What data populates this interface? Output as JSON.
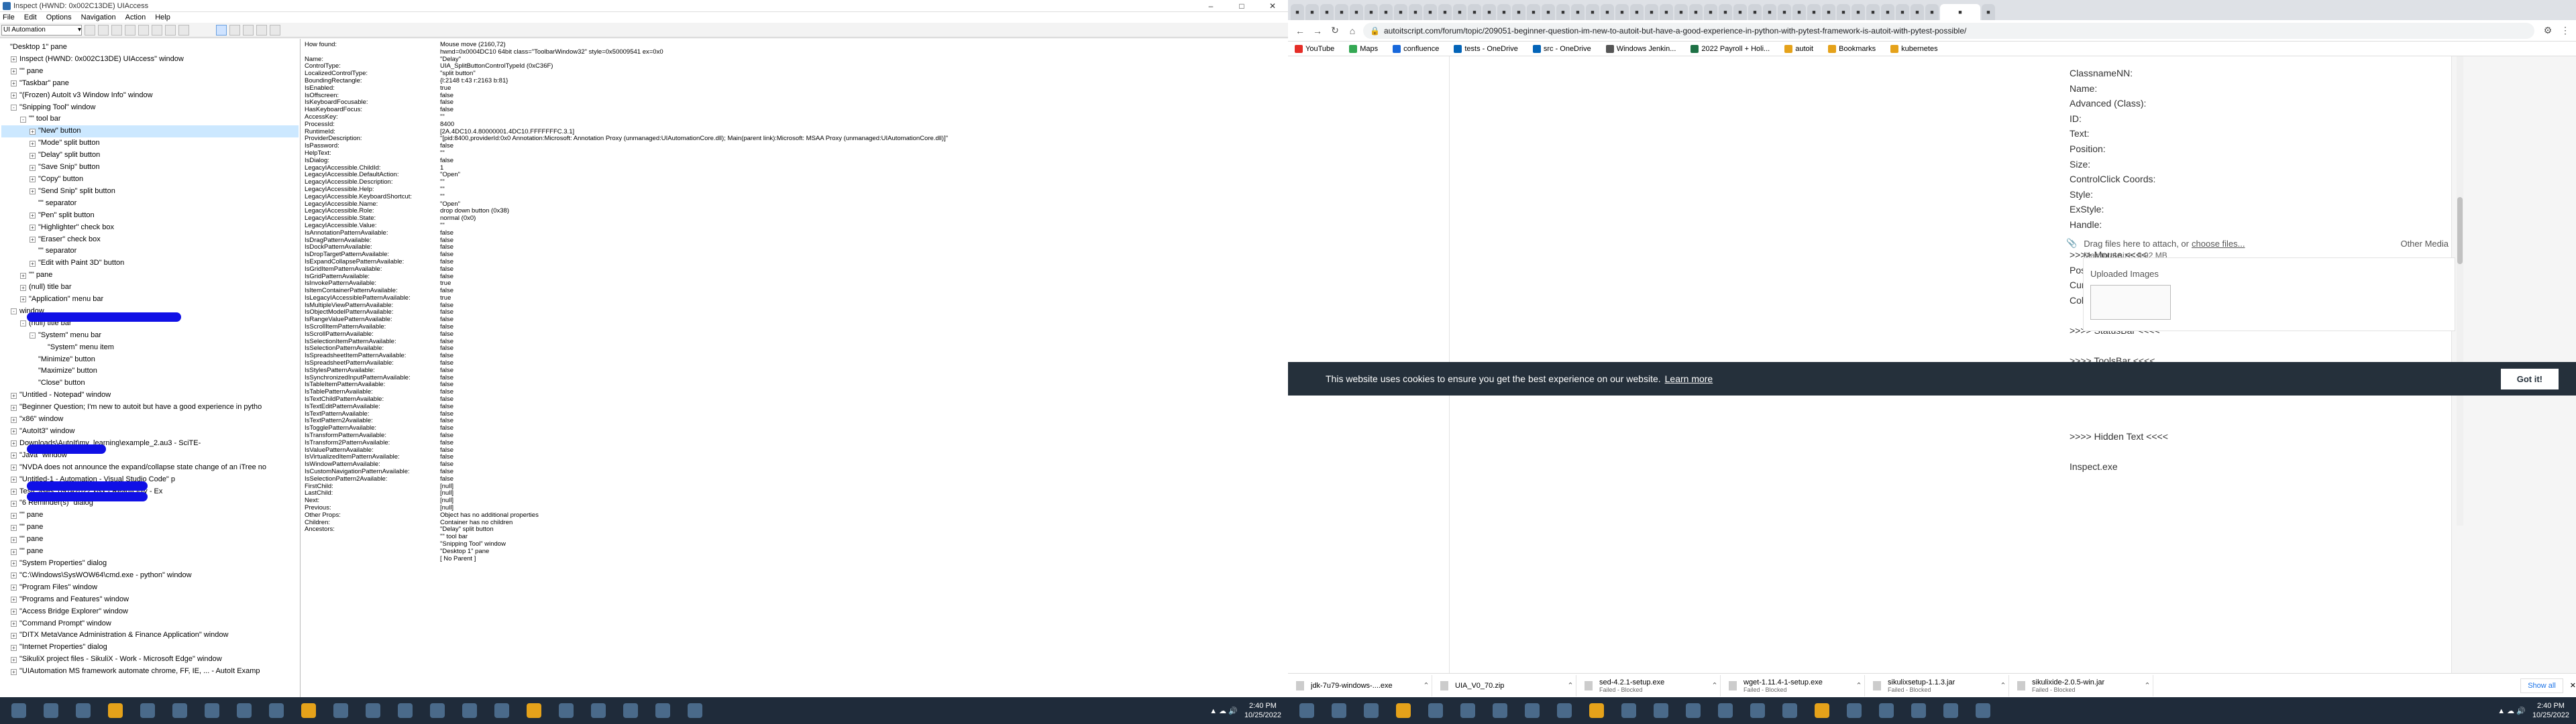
{
  "inspect": {
    "title": "Inspect (HWND: 0x002C13DE) UIAccess",
    "menu": [
      "File",
      "Edit",
      "Options",
      "Navigation",
      "Action",
      "Help"
    ],
    "mode": "UI Automation",
    "tree": [
      {
        "indent": 0,
        "tog": "",
        "text": "\"Desktop 1\" pane"
      },
      {
        "indent": 1,
        "tog": "+",
        "text": "Inspect  (HWND: 0x002C13DE) UIAccess\" window"
      },
      {
        "indent": 1,
        "tog": "+",
        "text": "\"\" pane"
      },
      {
        "indent": 1,
        "tog": "+",
        "text": "\"Taskbar\" pane"
      },
      {
        "indent": 1,
        "tog": "+",
        "text": "\"(Frozen) AutoIt v3 Window Info\" window"
      },
      {
        "indent": 1,
        "tog": "-",
        "text": "\"Snipping Tool\" window"
      },
      {
        "indent": 2,
        "tog": "-",
        "text": "\"\" tool bar"
      },
      {
        "indent": 3,
        "tog": "+",
        "text": "\"New\" button",
        "sel": true
      },
      {
        "indent": 3,
        "tog": "+",
        "text": "\"Mode\" split button"
      },
      {
        "indent": 3,
        "tog": "+",
        "text": "\"Delay\" split button"
      },
      {
        "indent": 3,
        "tog": "+",
        "text": "\"Save Snip\" button"
      },
      {
        "indent": 3,
        "tog": "+",
        "text": "\"Copy\" button"
      },
      {
        "indent": 3,
        "tog": "+",
        "text": "\"Send Snip\" split button"
      },
      {
        "indent": 3,
        "tog": "",
        "text": "\"\" separator"
      },
      {
        "indent": 3,
        "tog": "+",
        "text": "\"Pen\" split button"
      },
      {
        "indent": 3,
        "tog": "+",
        "text": "\"Highlighter\" check box"
      },
      {
        "indent": 3,
        "tog": "+",
        "text": "\"Eraser\" check box"
      },
      {
        "indent": 3,
        "tog": "",
        "text": "\"\" separator"
      },
      {
        "indent": 3,
        "tog": "+",
        "text": "\"Edit with Paint 3D\" button"
      },
      {
        "indent": 2,
        "tog": "+",
        "text": "\"\" pane"
      },
      {
        "indent": 2,
        "tog": "+",
        "text": "(null) title bar"
      },
      {
        "indent": 2,
        "tog": "+",
        "text": "\"Application\" menu bar"
      },
      {
        "indent": 1,
        "tog": "-",
        "text": "window",
        "redact": true
      },
      {
        "indent": 2,
        "tog": "-",
        "text": "(null) title bar"
      },
      {
        "indent": 3,
        "tog": "-",
        "text": "\"System\" menu bar"
      },
      {
        "indent": 4,
        "tog": "",
        "text": "\"System\" menu item"
      },
      {
        "indent": 3,
        "tog": "",
        "text": "\"Minimize\" button"
      },
      {
        "indent": 3,
        "tog": "",
        "text": "\"Maximize\" button"
      },
      {
        "indent": 3,
        "tog": "",
        "text": "\"Close\" button"
      },
      {
        "indent": 1,
        "tog": "+",
        "text": "\"Untitled - Notepad\" window"
      },
      {
        "indent": 1,
        "tog": "+",
        "text": "\"Beginner Question; I'm new to autoit but have a good experience in pytho"
      },
      {
        "indent": 1,
        "tog": "+",
        "text": "\"x86\" window"
      },
      {
        "indent": 1,
        "tog": "+",
        "text": "\"AutoIt3\" window"
      },
      {
        "indent": 1,
        "tog": "+",
        "text": "Downloads\\AutoIt\\my_learning\\example_2.au3 - SciTE-",
        "redact": true
      },
      {
        "indent": 1,
        "tog": "+",
        "text": "\"Java\" window"
      },
      {
        "indent": 1,
        "tog": "+",
        "text": "\"NVDA does not announce the expand/collapse state change of an iTree no"
      },
      {
        "indent": 1,
        "tog": "+",
        "text": "\"Untitled-1 -                  Automation - Visual Studio Code\" p",
        "redact": true
      },
      {
        "indent": 1,
        "tog": "+",
        "text": "                          TestCases_09142022.xlsx  -  Read-Only - Ex",
        "redact": true
      },
      {
        "indent": 1,
        "tog": "+",
        "text": "\"6 Reminder(s)\" dialog"
      },
      {
        "indent": 1,
        "tog": "+",
        "text": "\"\" pane"
      },
      {
        "indent": 1,
        "tog": "+",
        "text": "\"\" pane"
      },
      {
        "indent": 1,
        "tog": "+",
        "text": "\"\" pane"
      },
      {
        "indent": 1,
        "tog": "+",
        "text": "\"\" pane"
      },
      {
        "indent": 1,
        "tog": "+",
        "text": "\"System Properties\" dialog"
      },
      {
        "indent": 1,
        "tog": "+",
        "text": "\"C:\\Windows\\SysWOW64\\cmd.exe - python\" window"
      },
      {
        "indent": 1,
        "tog": "+",
        "text": "\"Program Files\" window"
      },
      {
        "indent": 1,
        "tog": "+",
        "text": "\"Programs and Features\" window"
      },
      {
        "indent": 1,
        "tog": "+",
        "text": "\"Access Bridge Explorer\" window"
      },
      {
        "indent": 1,
        "tog": "+",
        "text": "\"Command Prompt\" window"
      },
      {
        "indent": 1,
        "tog": "+",
        "text": "\"DITX MetaVance Administration & Finance Application\" window"
      },
      {
        "indent": 1,
        "tog": "+",
        "text": "\"Internet Properties\" dialog"
      },
      {
        "indent": 1,
        "tog": "+",
        "text": "\"SikuliX project files - SikuliX - Work - Microsoft Edge\" window"
      },
      {
        "indent": 1,
        "tog": "+",
        "text": "\"UIAutomation MS framework automate chrome, FF, IE, ... - AutoIt Examp"
      }
    ],
    "props": [
      [
        "How found:",
        "Mouse move (2160,72)"
      ],
      [
        "",
        "hwnd=0x0004DC10 64bit class=\"ToolbarWindow32\" style=0x50009541 ex=0x0"
      ],
      [
        "Name:",
        "\"Delay\""
      ],
      [
        "ControlType:",
        "UIA_SplitButtonControlTypeId (0xC36F)"
      ],
      [
        "LocalizedControlType:",
        "\"split button\""
      ],
      [
        "BoundingRectangle:",
        "{l:2148 t:43 r:2163 b:81}"
      ],
      [
        "IsEnabled:",
        "true"
      ],
      [
        "IsOffscreen:",
        "false"
      ],
      [
        "IsKeyboardFocusable:",
        "false"
      ],
      [
        "HasKeyboardFocus:",
        "false"
      ],
      [
        "AccessKey:",
        "\"\""
      ],
      [
        "ProcessId:",
        "8400"
      ],
      [
        "RuntimeId:",
        "[2A.4DC10.4.80000001.4DC10.FFFFFFFC.3.1]"
      ],
      [
        "ProviderDescription:",
        "\"[pid:8400,providerId:0x0 Annotation:Microsoft: Annotation Proxy (unmanaged:UIAutomationCore.dll); Main(parent link):Microsoft: MSAA Proxy (unmanaged:UIAutomationCore.dll)]\""
      ],
      [
        "IsPassword:",
        "false"
      ],
      [
        "HelpText:",
        "\"\""
      ],
      [
        "IsDialog:",
        "false"
      ],
      [
        "LegacyIAccessible.ChildId:",
        "1"
      ],
      [
        "LegacyIAccessible.DefaultAction:",
        "\"Open\""
      ],
      [
        "LegacyIAccessible.Description:",
        "\"\""
      ],
      [
        "LegacyIAccessible.Help:",
        "\"\""
      ],
      [
        "LegacyIAccessible.KeyboardShortcut:",
        "\"\""
      ],
      [
        "LegacyIAccessible.Name:",
        "\"Open\""
      ],
      [
        "LegacyIAccessible.Role:",
        "drop down button (0x38)"
      ],
      [
        "LegacyIAccessible.State:",
        "normal (0x0)"
      ],
      [
        "LegacyIAccessible.Value:",
        "\"\""
      ],
      [
        "IsAnnotationPatternAvailable:",
        "false"
      ],
      [
        "IsDragPatternAvailable:",
        "false"
      ],
      [
        "IsDockPatternAvailable:",
        "false"
      ],
      [
        "IsDropTargetPatternAvailable:",
        "false"
      ],
      [
        "IsExpandCollapsePatternAvailable:",
        "false"
      ],
      [
        "IsGridItemPatternAvailable:",
        "false"
      ],
      [
        "IsGridPatternAvailable:",
        "false"
      ],
      [
        "IsInvokePatternAvailable:",
        "true"
      ],
      [
        "IsItemContainerPatternAvailable:",
        "false"
      ],
      [
        "IsLegacyIAccessiblePatternAvailable:",
        "true"
      ],
      [
        "IsMultipleViewPatternAvailable:",
        "false"
      ],
      [
        "IsObjectModelPatternAvailable:",
        "false"
      ],
      [
        "IsRangeValuePatternAvailable:",
        "false"
      ],
      [
        "IsScrollItemPatternAvailable:",
        "false"
      ],
      [
        "IsScrollPatternAvailable:",
        "false"
      ],
      [
        "IsSelectionItemPatternAvailable:",
        "false"
      ],
      [
        "IsSelectionPatternAvailable:",
        "false"
      ],
      [
        "IsSpreadsheetItemPatternAvailable:",
        "false"
      ],
      [
        "IsSpreadsheetPatternAvailable:",
        "false"
      ],
      [
        "IsStylesPatternAvailable:",
        "false"
      ],
      [
        "IsSynchronizedInputPatternAvailable:",
        "false"
      ],
      [
        "IsTableItemPatternAvailable:",
        "false"
      ],
      [
        "IsTablePatternAvailable:",
        "false"
      ],
      [
        "IsTextChildPatternAvailable:",
        "false"
      ],
      [
        "IsTextEditPatternAvailable:",
        "false"
      ],
      [
        "IsTextPatternAvailable:",
        "false"
      ],
      [
        "IsTextPattern2Available:",
        "false"
      ],
      [
        "IsTogglePatternAvailable:",
        "false"
      ],
      [
        "IsTransformPatternAvailable:",
        "false"
      ],
      [
        "IsTransform2PatternAvailable:",
        "false"
      ],
      [
        "IsValuePatternAvailable:",
        "false"
      ],
      [
        "IsVirtualizedItemPatternAvailable:",
        "false"
      ],
      [
        "IsWindowPatternAvailable:",
        "false"
      ],
      [
        "IsCustomNavigationPatternAvailable:",
        "false"
      ],
      [
        "IsSelectionPattern2Available:",
        "false"
      ],
      [
        "FirstChild:",
        "[null]"
      ],
      [
        "LastChild:",
        "[null]"
      ],
      [
        "Next:",
        "[null]"
      ],
      [
        "Previous:",
        "[null]"
      ],
      [
        "Other Props:",
        "Object has no additional properties"
      ],
      [
        "Children:",
        "Container has no children"
      ],
      [
        "Ancestors:",
        "\"Delay\" split button"
      ],
      [
        "",
        "\"\" tool bar"
      ],
      [
        "",
        "\"Snipping Tool\" window"
      ],
      [
        "",
        "\"Desktop 1\" pane"
      ],
      [
        "",
        "[ No Parent ]"
      ]
    ]
  },
  "taskbar_left": {
    "time": "2:40 PM",
    "date": "10/25/2022"
  },
  "browser": {
    "tabs_count": 46,
    "url": "autoitscript.com/forum/topic/209051-beginner-question-im-new-to-autoit-but-have-a-good-experience-in-python-with-pytest-framework-is-autoit-with-pytest-possible/",
    "bookmarks": [
      "YouTube",
      "Maps",
      "confluence",
      "tests - OneDrive",
      "src - OneDrive",
      "Windows Jenkin...",
      "2022 Payroll + Holi...",
      "autoit",
      "Bookmarks",
      "kubernetes"
    ],
    "post_lines": [
      "ClassnameNN:",
      "Name:",
      "Advanced (Class):",
      "ID:",
      "Text:",
      "Position:",
      "Size:",
      "ControlClick Coords:",
      "Style:",
      "ExStyle:",
      "Handle:",
      "",
      ">>>> Mouse <<<<",
      "Position:    894, 364",
      "Cursor ID:    0",
      "Color:   0xFFFFFF",
      "",
      ">>>> StatusBar <<<<",
      "",
      ">>>> ToolsBar <<<<",
      "",
      ">>>> Visible Text <<<<",
      "",
      "",
      ">>>> Hidden Text <<<<",
      "",
      "Inspect.exe"
    ],
    "attach_text": "Drag files here to attach, or",
    "attach_link": "choose files...",
    "other_media": "Other Media",
    "max_size": "Max total size: 3.92 MB",
    "uploaded_title": "Uploaded Images",
    "cookie_msg": "This website uses cookies to ensure you get the best experience on our website.",
    "cookie_link": "Learn more",
    "cookie_btn": "Got it!",
    "downloads": [
      {
        "name": "jdk-7u79-windows-....exe",
        "sub": ""
      },
      {
        "name": "UIA_V0_70.zip",
        "sub": ""
      },
      {
        "name": "sed-4.2.1-setup.exe",
        "sub": "Failed - Blocked"
      },
      {
        "name": "wget-1.11.4-1-setup.exe",
        "sub": "Failed - Blocked"
      },
      {
        "name": "sikulixsetup-1.1.3.jar",
        "sub": "Failed - Blocked"
      },
      {
        "name": "sikulixide-2.0.5-win.jar",
        "sub": "Failed - Blocked"
      }
    ],
    "show_all": "Show all"
  },
  "taskbar_right": {
    "time": "2:40 PM",
    "date": "10/25/2022"
  }
}
